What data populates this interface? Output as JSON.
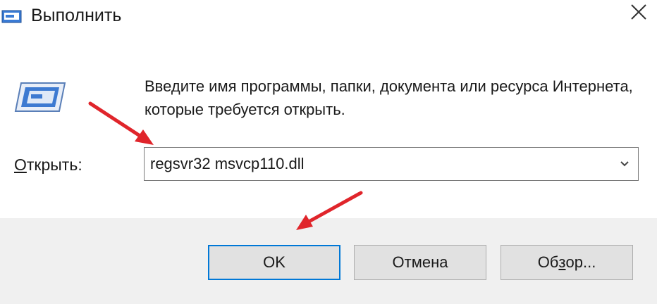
{
  "window": {
    "title": "Выполнить",
    "close_icon": "close-icon"
  },
  "content": {
    "message": "Введите имя программы, папки, документа или ресурса Интернета, которые требуется открыть.",
    "open_label_underlined": "О",
    "open_label_rest": "ткрыть:",
    "command_value": "regsvr32 msvcp110.dll"
  },
  "buttons": {
    "ok": "OK",
    "cancel": "Отмена",
    "browse_before": "Об",
    "browse_underlined": "з",
    "browse_after": "ор..."
  },
  "colors": {
    "annotation_arrow": "#e0252b",
    "ok_focus_border": "#0078d7",
    "footer_bg": "#f0f0f0",
    "button_bg": "#e1e1e1"
  },
  "icons": [
    "run-app-icon",
    "run-dialog-icon",
    "close-icon",
    "chevron-down-icon"
  ]
}
